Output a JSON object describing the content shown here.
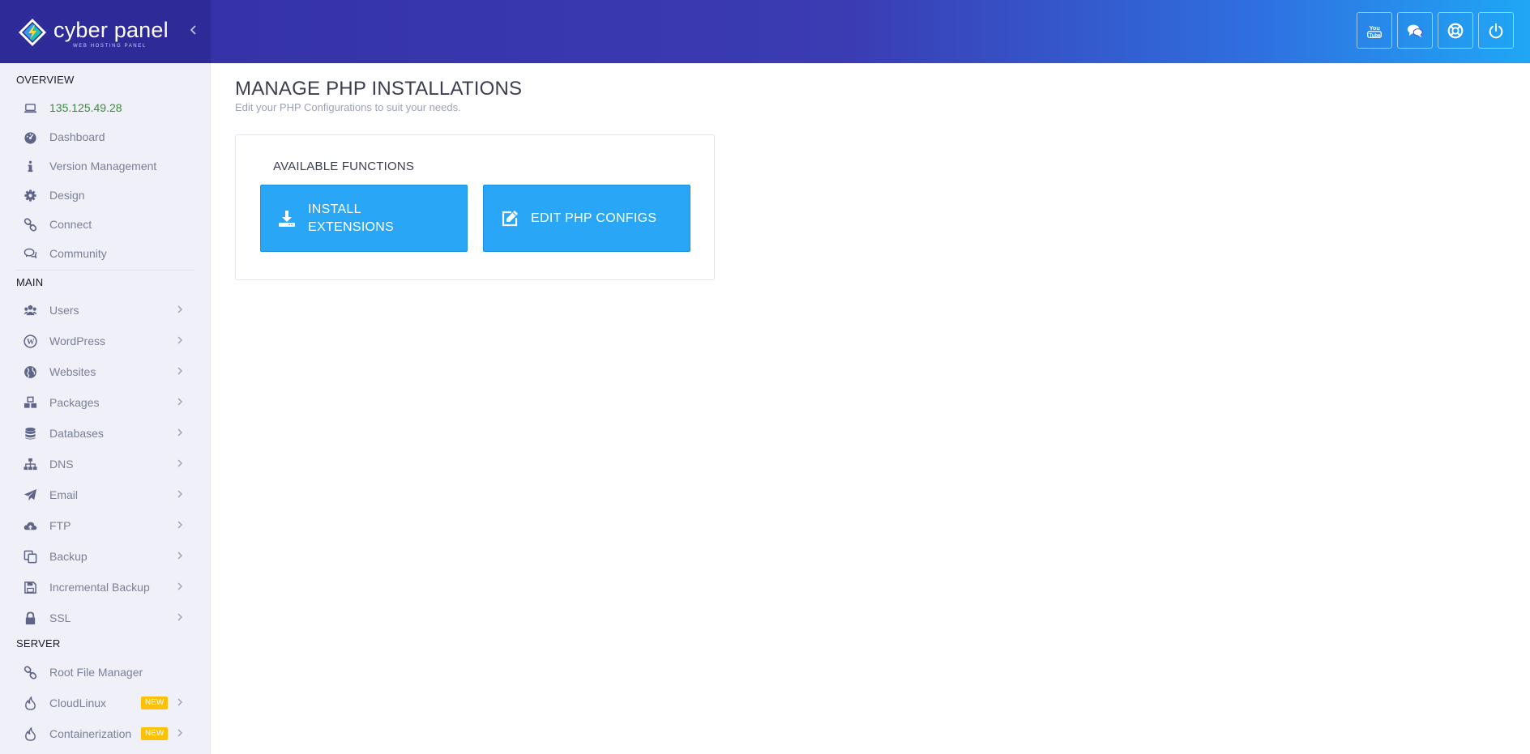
{
  "brand": {
    "name": "cyber panel",
    "tagline": "WEB HOSTING PANEL"
  },
  "header": {
    "buttons": [
      {
        "name": "youtube",
        "icon": "youtube-icon"
      },
      {
        "name": "chat",
        "icon": "chat-icon"
      },
      {
        "name": "support",
        "icon": "lifebuoy-icon"
      },
      {
        "name": "logout",
        "icon": "power-icon"
      }
    ]
  },
  "sidebar": {
    "overview_title": "OVERVIEW",
    "overview": [
      {
        "label": "135.125.49.28",
        "icon": "laptop-icon"
      },
      {
        "label": "Dashboard",
        "icon": "dashboard-icon"
      },
      {
        "label": "Version Management",
        "icon": "info-icon"
      },
      {
        "label": "Design",
        "icon": "gear-icon"
      },
      {
        "label": "Connect",
        "icon": "link-icon"
      },
      {
        "label": "Community",
        "icon": "comments-icon"
      }
    ],
    "main_title": "MAIN",
    "main": [
      {
        "label": "Users",
        "icon": "users-icon"
      },
      {
        "label": "WordPress",
        "icon": "wordpress-icon"
      },
      {
        "label": "Websites",
        "icon": "globe-icon"
      },
      {
        "label": "Packages",
        "icon": "cubes-icon"
      },
      {
        "label": "Databases",
        "icon": "database-icon"
      },
      {
        "label": "DNS",
        "icon": "sitemap-icon"
      },
      {
        "label": "Email",
        "icon": "paper-plane-icon"
      },
      {
        "label": "FTP",
        "icon": "cloud-upload-icon"
      },
      {
        "label": "Backup",
        "icon": "copy-icon"
      },
      {
        "label": "Incremental Backup",
        "icon": "save-icon"
      },
      {
        "label": "SSL",
        "icon": "lock-icon"
      }
    ],
    "server_title": "SERVER",
    "server": [
      {
        "label": "Root File Manager",
        "icon": "link-icon"
      },
      {
        "label": "CloudLinux",
        "icon": "fire-icon",
        "badge": "NEW"
      },
      {
        "label": "Containerization",
        "icon": "fire-icon",
        "badge": "NEW"
      }
    ]
  },
  "main": {
    "title": "MANAGE PHP INSTALLATIONS",
    "subtitle": "Edit your PHP Configurations to suit your needs.",
    "panel_title": "AVAILABLE FUNCTIONS",
    "functions": [
      {
        "label": "INSTALL\nEXTENSIONS",
        "line1": "INSTALL",
        "line2": "EXTENSIONS",
        "icon": "download-icon"
      },
      {
        "label": "EDIT PHP CONFIGS",
        "icon": "edit-icon"
      }
    ]
  },
  "colors": {
    "accent": "#29a6f6",
    "header_start": "#3430a4",
    "header_end": "#1fa7f5",
    "sidebar_bg": "#eff0f8",
    "badge": "#ffc107",
    "ip_text": "#3a8a3a"
  }
}
